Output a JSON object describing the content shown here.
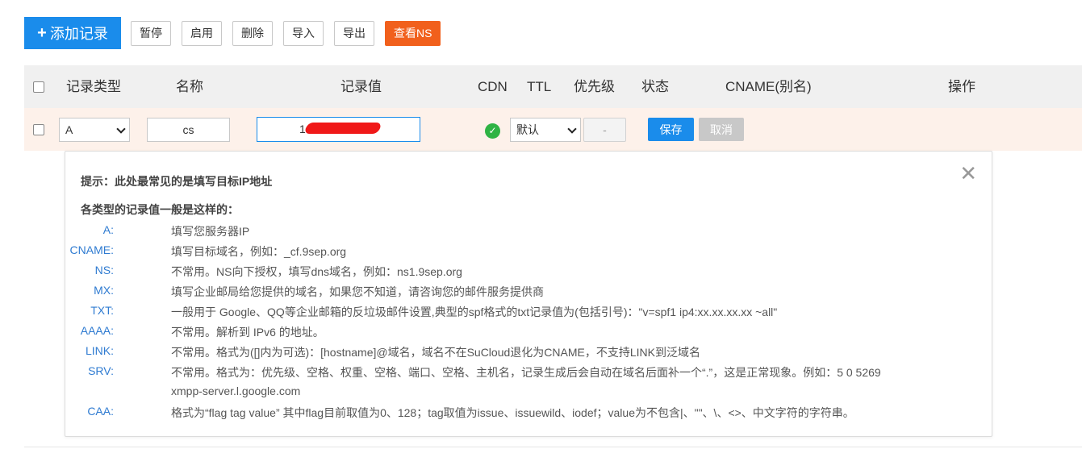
{
  "toolbar": {
    "add_label": "添加记录",
    "pause_label": "暂停",
    "enable_label": "启用",
    "delete_label": "删除",
    "import_label": "导入",
    "export_label": "导出",
    "view_ns_label": "查看NS"
  },
  "table_header": {
    "type": "记录类型",
    "name": "名称",
    "value": "记录值",
    "cdn": "CDN",
    "ttl": "TTL",
    "priority": "优先级",
    "status": "状态",
    "cname": "CNAME(别名)",
    "actions": "操作"
  },
  "edit_row": {
    "record_type": "A",
    "name_value": "cs",
    "record_value_visible": "1",
    "ttl": "默认",
    "priority": "-",
    "save_label": "保存",
    "cancel_label": "取消"
  },
  "tip": {
    "title": "提示：此处最常见的是填写目标IP地址",
    "subtitle": "各类型的记录值一般是这样的：",
    "close_symbol": "✕",
    "rows": [
      {
        "key": "A:",
        "value": "填写您服务器IP"
      },
      {
        "key": "CNAME:",
        "value": "填写目标域名，例如：_cf.9sep.org"
      },
      {
        "key": "NS:",
        "value": "不常用。NS向下授权，填写dns域名，例如：ns1.9sep.org"
      },
      {
        "key": "MX:",
        "value": "填写企业邮局给您提供的域名，如果您不知道，请咨询您的邮件服务提供商"
      },
      {
        "key": "TXT:",
        "value": "一般用于 Google、QQ等企业邮箱的反垃圾邮件设置,典型的spf格式的txt记录值为(包括引号)：\"v=spf1 ip4:xx.xx.xx.xx ~all\""
      },
      {
        "key": "AAAA:",
        "value": "不常用。解析到 IPv6 的地址。"
      },
      {
        "key": "LINK:",
        "value": "不常用。格式为([]内为可选)：[hostname]@域名，域名不在SuCloud退化为CNAME，不支持LINK到泛域名"
      },
      {
        "key": "SRV:",
        "value": "不常用。格式为：优先级、空格、权重、空格、端口、空格、主机名，记录生成后会自动在域名后面补一个“.”，这是正常现象。例如：5 0 5269"
      },
      {
        "key": "",
        "value": "xmpp-server.l.google.com"
      },
      {
        "key": "CAA:",
        "value": "格式为“flag tag value” 其中flag目前取值为0、128；tag取值为issue、issuewild、iodef；value为不包含|、\"\"、\\、<>、中文字符的字符串。"
      }
    ]
  },
  "colors": {
    "primary": "#1a8ceb",
    "ns_button": "#f1601c",
    "row_highlight": "#fdf1ea",
    "header_bg": "#f0f0f0",
    "cdn_on": "#2fb344"
  }
}
